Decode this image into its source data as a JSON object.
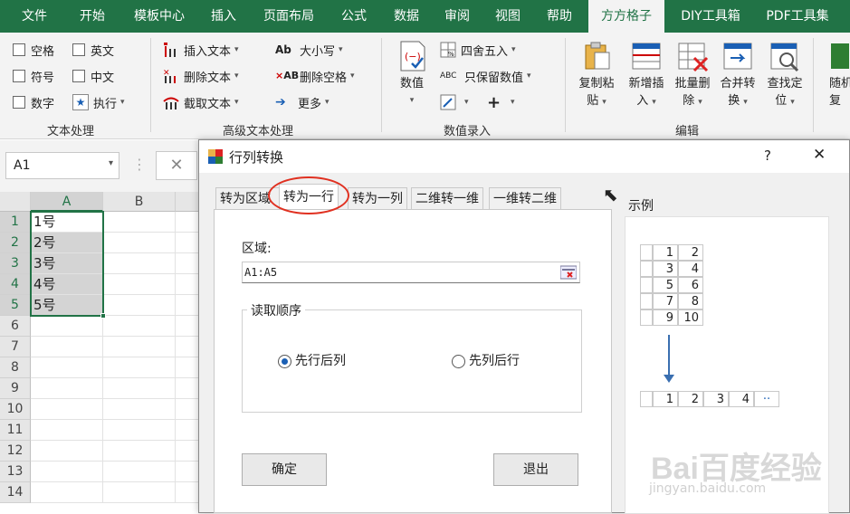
{
  "ribbon_tabs": [
    "文件",
    "开始",
    "模板中心",
    "插入",
    "页面布局",
    "公式",
    "数据",
    "审阅",
    "视图",
    "帮助",
    "方方格子",
    "DIY工具箱",
    "PDF工具集"
  ],
  "active_tab": "方方格子",
  "text_group": {
    "checks": [
      "空格",
      "英文",
      "符号",
      "中文",
      "数字"
    ],
    "execute": "执行",
    "label": "文本处理"
  },
  "adv_group": {
    "insert": "插入文本",
    "delete": "删除文本",
    "cut": "截取文本",
    "case": "大小写",
    "del_space": "删除空格",
    "more": "更多",
    "label": "高级文本处理"
  },
  "num_group": {
    "value": "数值",
    "round": "四舍五入",
    "keep_value": "只保留数值",
    "plus": "+",
    "label": "数值录入"
  },
  "edit_group": {
    "buttons": [
      {
        "l1": "复制粘",
        "l2": "贴"
      },
      {
        "l1": "新增插",
        "l2": "入"
      },
      {
        "l1": "批量删",
        "l2": "除"
      },
      {
        "l1": "合并转",
        "l2": "换"
      },
      {
        "l1": "查找定",
        "l2": "位"
      },
      {
        "l1": "随机",
        "l2": "复"
      }
    ],
    "label": "编辑"
  },
  "name_box": "A1",
  "sheet": {
    "columns": [
      "A",
      "B"
    ],
    "rows": [
      "1",
      "2",
      "3",
      "4",
      "5",
      "6",
      "7",
      "8",
      "9",
      "10",
      "11",
      "12",
      "13",
      "14"
    ],
    "values": [
      "1号",
      "2号",
      "3号",
      "4号",
      "5号"
    ]
  },
  "dialog": {
    "title": "行列转换",
    "help": "?",
    "close": "✕",
    "tabs": [
      "转为区域",
      "转为一行",
      "转为一列",
      "二维转一维",
      "一维转二维"
    ],
    "active_tab": "转为一行",
    "range_label": "区域:",
    "range_value": "A1:A5",
    "order_label": "读取顺序",
    "radio_row_first": "先行后列",
    "radio_col_first": "先列后行",
    "selected_radio": "先行后列",
    "ok": "确定",
    "exit": "退出",
    "example_label": "示例",
    "example_grid": [
      [
        "1",
        "2"
      ],
      [
        "3",
        "4"
      ],
      [
        "5",
        "6"
      ],
      [
        "7",
        "8"
      ],
      [
        "9",
        "10"
      ]
    ],
    "example_result": [
      "1",
      "2",
      "3",
      "4",
      "··"
    ]
  },
  "watermark": {
    "brand": "Bai百度经验",
    "url": "jingyan.baidu.com"
  }
}
